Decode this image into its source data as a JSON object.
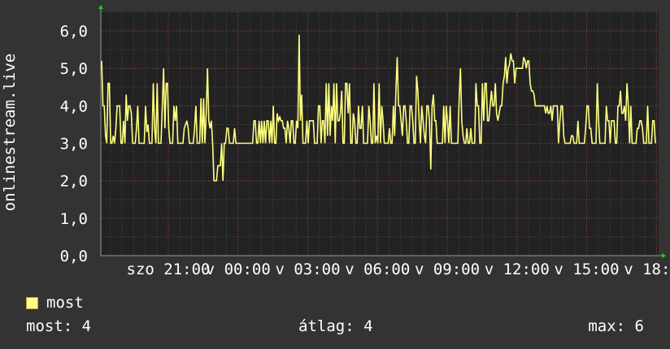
{
  "chart_data": {
    "type": "line",
    "ylabel": "onlinestream.live",
    "ylim": [
      0,
      6.5
    ],
    "y_ticks": [
      "0,0",
      "1,0",
      "2,0",
      "3,0",
      "4,0",
      "5,0",
      "6,0"
    ],
    "x_ticks": [
      "szo 21:00",
      "v 00:00",
      "v 03:00",
      "v 06:00",
      "v 09:00",
      "v 12:00",
      "v 15:00",
      "v 18:00"
    ],
    "grid": true,
    "series": [
      {
        "name": "most",
        "color": "#ffff80",
        "values": [
          5.2,
          4.0,
          4.0,
          3.2,
          3.0,
          4.6,
          4.6,
          3.0,
          3.0,
          3.2,
          3.0,
          3.4,
          4.0,
          4.0,
          4.0,
          3.0,
          3.0,
          3.6,
          3.0,
          4.3,
          3.6,
          4.0,
          4.0,
          3.8,
          3.0,
          3.0,
          3.0,
          3.4,
          4.0,
          3.0,
          3.0,
          3.0,
          3.0,
          3.0,
          4.0,
          3.3,
          3.5,
          3.0,
          3.0,
          3.0,
          4.6,
          3.4,
          3.0,
          4.6,
          3.0,
          3.0,
          3.0,
          4.0,
          5.0,
          3.4,
          4.6,
          4.6,
          3.4,
          3.0,
          3.0,
          3.0,
          4.0,
          3.6,
          4.0,
          3.0,
          3.0,
          3.0,
          3.0,
          3.0,
          3.4,
          3.5,
          3.6,
          3.4,
          3.0,
          3.0,
          3.0,
          3.0,
          3.4,
          4.0,
          3.0,
          3.0,
          3.0,
          4.2,
          3.0,
          4.2,
          3.0,
          3.8,
          5.0,
          3.6,
          3.4,
          3.6,
          3.0,
          2.0,
          2.0,
          2.0,
          2.4,
          2.4,
          2.4,
          3.0,
          2.0,
          3.0,
          3.0,
          3.4,
          3.4,
          3.0,
          3.0,
          3.0,
          3.0,
          3.4,
          3.0,
          3.0,
          3.0,
          3.0,
          3.0,
          3.0,
          3.0,
          3.0,
          3.0,
          3.0,
          3.0,
          3.0,
          3.0,
          3.0,
          3.6,
          3.6,
          3.0,
          3.0,
          3.6,
          3.0,
          3.6,
          3.0,
          3.6,
          3.0,
          3.6,
          3.6,
          3.0,
          3.6,
          3.0,
          4.0,
          3.0,
          3.0,
          3.8,
          3.6,
          3.7,
          3.6,
          3.6,
          3.4,
          3.4,
          3.0,
          3.6,
          3.4,
          3.0,
          3.6,
          3.6,
          3.0,
          3.0,
          3.6,
          3.4,
          5.9,
          3.6,
          4.3,
          3.0,
          3.0,
          3.0,
          3.6,
          3.0,
          3.6,
          3.6,
          3.6,
          3.6,
          3.0,
          3.0,
          3.0,
          4.0,
          4.0,
          3.0,
          3.6,
          3.6,
          3.0,
          4.6,
          3.2,
          4.6,
          3.2,
          4.0,
          3.6,
          4.6,
          3.0,
          4.6,
          3.6,
          3.6,
          3.8,
          4.4,
          3.0,
          3.0,
          4.6,
          4.6,
          3.8,
          4.6,
          3.0,
          3.0,
          3.8,
          3.6,
          3.0,
          3.0,
          4.0,
          3.4,
          3.4,
          4.0,
          3.0,
          3.0,
          3.0,
          3.0,
          4.0,
          3.6,
          3.0,
          3.0,
          4.6,
          3.0,
          3.2,
          3.0,
          4.6,
          3.0,
          4.0,
          3.6,
          3.0,
          3.0,
          3.0,
          3.0,
          3.4,
          3.0,
          3.0,
          4.0,
          3.2,
          4.4,
          5.3,
          4.0,
          4.0,
          3.6,
          3.2,
          4.0,
          4.0,
          3.6,
          3.0,
          3.0,
          4.0,
          4.0,
          3.6,
          3.0,
          3.0,
          4.8,
          4.4,
          3.6,
          3.0,
          4.0,
          3.6,
          3.2,
          3.0,
          4.0,
          4.0,
          3.6,
          2.3,
          4.0,
          4.3,
          3.6,
          3.6,
          3.0,
          3.0,
          3.0,
          3.0,
          3.0,
          4.0,
          3.0,
          4.0,
          3.6,
          3.0,
          4.0,
          3.0,
          3.0,
          3.0,
          3.0,
          3.0,
          3.0,
          4.2,
          5.0,
          3.6,
          3.2,
          3.0,
          3.0,
          3.4,
          3.0,
          3.0,
          3.4,
          3.0,
          3.0,
          3.0,
          4.6,
          4.0,
          4.0,
          3.0,
          3.0,
          4.6,
          3.6,
          4.6,
          4.6,
          3.6,
          3.6,
          4.0,
          4.4,
          4.0,
          4.0,
          4.6,
          3.8,
          3.6,
          3.8,
          4.0,
          4.0,
          4.6,
          4.8,
          5.3,
          4.6,
          5.0,
          5.1,
          5.4,
          5.2,
          5.2,
          4.6,
          5.0,
          5.0,
          5.0,
          5.0,
          5.0,
          5.0,
          5.3,
          5.2,
          5.0,
          5.2,
          5.2,
          4.6,
          4.4,
          4.4,
          4.3,
          4.0,
          4.0,
          4.0,
          4.0,
          4.0,
          4.0,
          4.0,
          4.0,
          3.8,
          4.0,
          3.8,
          3.8,
          4.0,
          3.6,
          4.0,
          4.0,
          4.0,
          4.0,
          3.0,
          3.6,
          4.0,
          4.0,
          3.2,
          3.0,
          3.0,
          3.0,
          3.0,
          3.0,
          3.2,
          3.2,
          3.0,
          3.0,
          3.0,
          3.6,
          3.0,
          3.0,
          3.0,
          3.0,
          3.0,
          3.4,
          4.0,
          4.0,
          3.4,
          3.4,
          3.0,
          3.0,
          3.0,
          3.0,
          4.6,
          3.6,
          3.0,
          3.0,
          3.0,
          3.0,
          3.0,
          4.0,
          3.6,
          3.6,
          3.0,
          3.6,
          3.6,
          3.6,
          3.0,
          3.0,
          4.0,
          4.0,
          4.4,
          3.8,
          3.8,
          4.0,
          3.6,
          4.6,
          4.0,
          3.0,
          4.0,
          3.0,
          3.0,
          3.0,
          3.0,
          3.4,
          3.4,
          3.6,
          3.6,
          3.4,
          3.0,
          3.0,
          3.0,
          4.0,
          3.0,
          3.0,
          3.0,
          3.6,
          3.6,
          3.0
        ]
      }
    ]
  },
  "legend": {
    "label": "most",
    "color": "#ffff80"
  },
  "stats": {
    "current_label": "most:",
    "current_value": "4",
    "avg_label": "átlag:",
    "avg_value": "4",
    "max_label": "max:",
    "max_value": "6"
  }
}
